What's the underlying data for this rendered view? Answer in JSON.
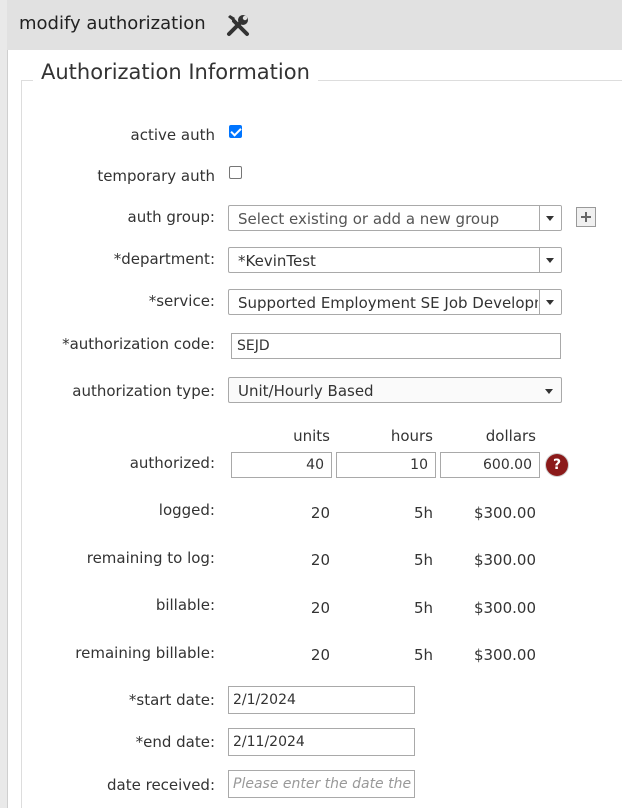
{
  "window": {
    "title": "modify authorization",
    "tool_icon": "tools-icon"
  },
  "section": {
    "legend": "Authorization Information"
  },
  "form": {
    "active_auth": {
      "label": "active auth",
      "checked": true
    },
    "temporary_auth": {
      "label": "temporary auth",
      "checked": false
    },
    "auth_group": {
      "label": "auth group:",
      "placeholder": "Select existing or add a new group",
      "add_icon": "plus-icon"
    },
    "department": {
      "label": "*department:",
      "value": "*KevinTest"
    },
    "service": {
      "label": "*service:",
      "value": "Supported Employment SE Job Development"
    },
    "authorization_code": {
      "label": "*authorization code:",
      "value": "SEJD"
    },
    "authorization_type": {
      "label": "authorization type:",
      "value": "Unit/Hourly Based"
    },
    "columns": {
      "units": "units",
      "hours": "hours",
      "dollars": "dollars"
    },
    "authorized": {
      "label": "authorized:",
      "units": "40",
      "hours": "10",
      "dollars": "600.00",
      "help_icon": "question-icon",
      "help_glyph": "?"
    },
    "logged": {
      "label": "logged:",
      "units": "20",
      "hours": "5h",
      "dollars": "$300.00"
    },
    "remaining_to_log": {
      "label": "remaining to log:",
      "units": "20",
      "hours": "5h",
      "dollars": "$300.00"
    },
    "billable": {
      "label": "billable:",
      "units": "20",
      "hours": "5h",
      "dollars": "$300.00"
    },
    "remaining_billable": {
      "label": "remaining billable:",
      "units": "20",
      "hours": "5h",
      "dollars": "$300.00"
    },
    "start_date": {
      "label": "*start date:",
      "value": "2/1/2024"
    },
    "end_date": {
      "label": "*end date:",
      "value": "2/11/2024"
    },
    "date_received": {
      "label": "date received:",
      "placeholder": "Please enter the date the au"
    }
  },
  "colors": {
    "titlebar_bg": "#e1e1e1",
    "checkbox_blue": "#0075ff",
    "help_icon_bg": "#8b1a1a"
  }
}
